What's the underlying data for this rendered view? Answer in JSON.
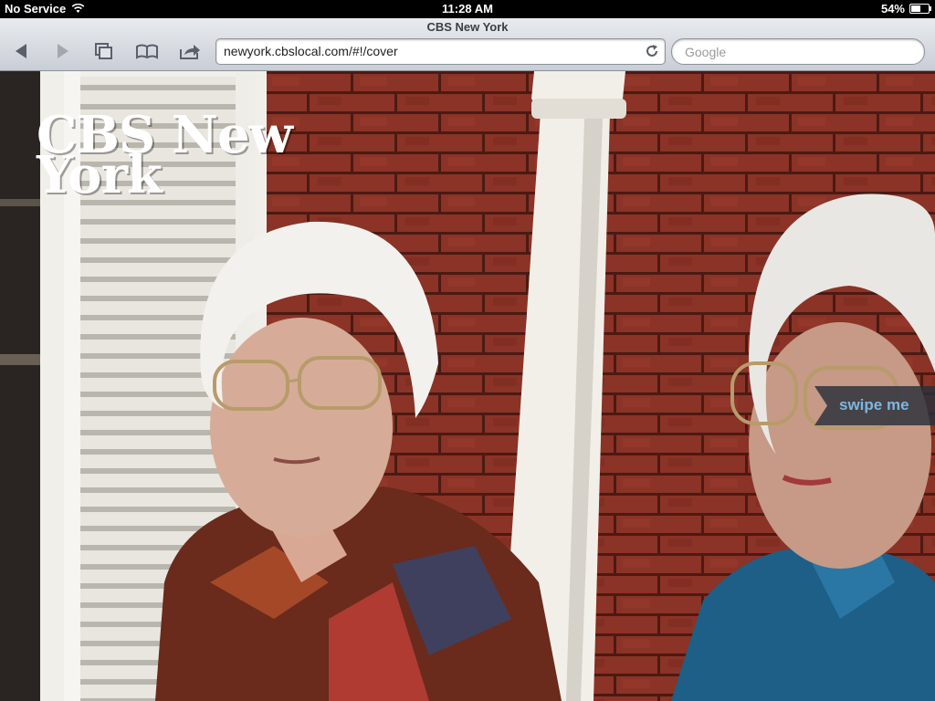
{
  "status": {
    "carrier": "No Service",
    "time": "11:28 AM",
    "battery": "54%",
    "battery_level": 0.54
  },
  "browser": {
    "page_title": "CBS New York",
    "url": "newyork.cbslocal.com/#!/cover",
    "search_placeholder": "Google"
  },
  "cover": {
    "title": "CBS New York",
    "swipe_label": "swipe me"
  },
  "colors": {
    "swipe_text": "#7fb6e0",
    "brick": "#8a3326"
  }
}
